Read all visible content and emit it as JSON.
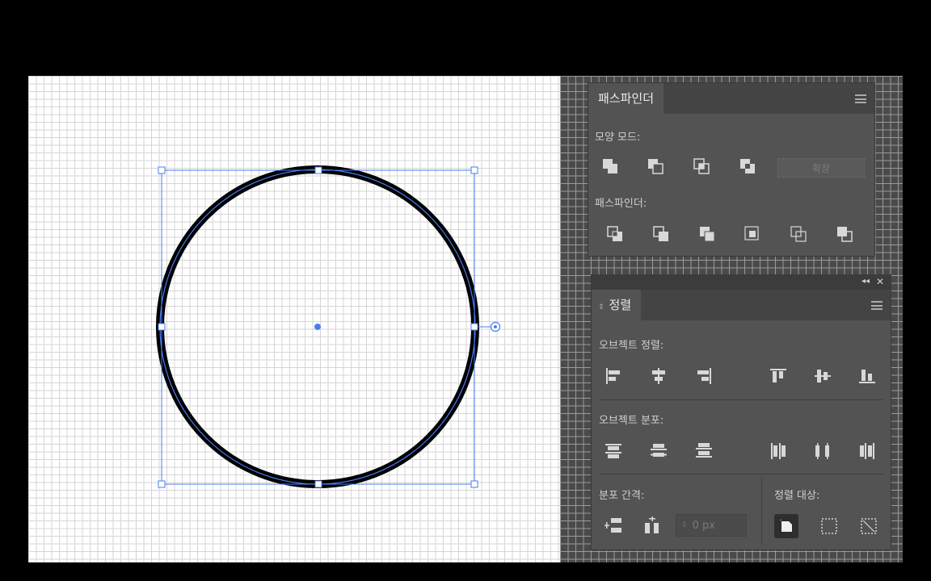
{
  "pathfinder_panel": {
    "tab_label": "패스파인더",
    "shape_modes_label": "모양 모드:",
    "expand_label": "확장",
    "pathfinders_label": "패스파인더:",
    "shape_mode_icons": [
      "unite-icon",
      "minus-front-icon",
      "intersect-icon",
      "exclude-icon"
    ],
    "pathfinder_icons": [
      "divide-icon",
      "trim-icon",
      "merge-icon",
      "crop-icon",
      "outline-icon",
      "minus-back-icon"
    ]
  },
  "align_panel": {
    "tab_label": "정렬",
    "collapse_glyph": "◂◂",
    "close_glyph": "✕",
    "align_objects_label": "오브젝트 정렬:",
    "distribute_objects_label": "오브젝트 분포:",
    "distribute_spacing_label": "분포 간격:",
    "align_to_label": "정렬 대상:",
    "spacing_value": "0 px",
    "align_icons": [
      "horizontal-align-left-icon",
      "horizontal-align-center-icon",
      "horizontal-align-right-icon",
      "vertical-align-top-icon",
      "vertical-align-center-icon",
      "vertical-align-bottom-icon"
    ],
    "distribute_icons": [
      "vertical-distribute-top-icon",
      "vertical-distribute-center-icon",
      "vertical-distribute-bottom-icon",
      "horizontal-distribute-left-icon",
      "horizontal-distribute-center-icon",
      "horizontal-distribute-right-icon"
    ]
  },
  "colors": {
    "selection": "#4a7cf0",
    "panel": "#535353",
    "icon": "#d8d8d8"
  }
}
